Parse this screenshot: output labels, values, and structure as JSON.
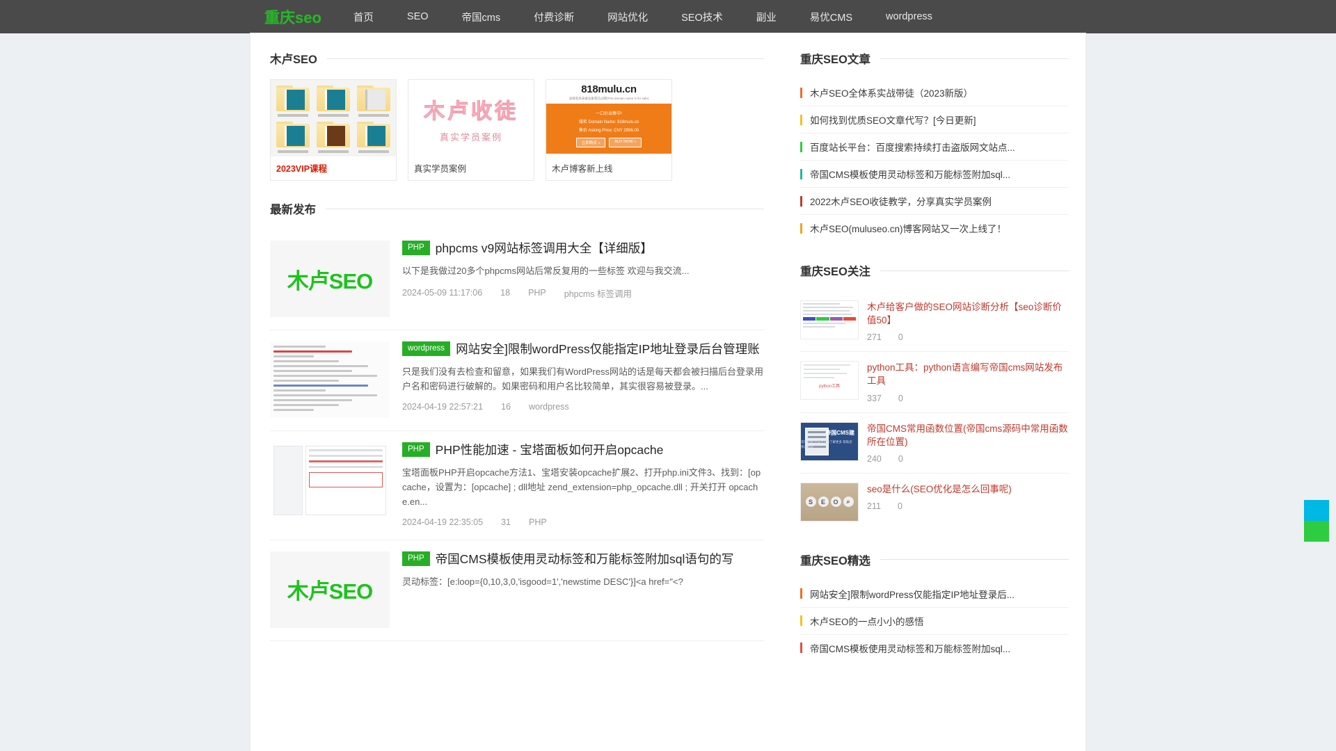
{
  "nav": {
    "logo": "重庆seo",
    "links": [
      {
        "label": "首页"
      },
      {
        "label": "SEO"
      },
      {
        "label": "帝国cms"
      },
      {
        "label": "付费诊断"
      },
      {
        "label": "网站优化"
      },
      {
        "label": "SEO技术"
      },
      {
        "label": "副业"
      },
      {
        "label": "易优CMS"
      },
      {
        "label": "wordpress"
      }
    ]
  },
  "main": {
    "featured_heading": "木卢SEO",
    "featured": [
      {
        "caption": "2023VIP课程",
        "kind": "folders",
        "highlight": true
      },
      {
        "caption": "真实学员案例",
        "kind": "mulu",
        "big": "木卢收徒",
        "sub": "真实学员案例",
        "highlight": false
      },
      {
        "caption": "木卢博客新上线",
        "kind": "mulu818",
        "domain": "818mulu.cn",
        "note": "该域名尚未被注册或已过期(This domain name is for sale)",
        "line1": "一口价出售中!",
        "line2": "域名 Domain Name: 818mulu.cn",
        "line3": "售价 Asking Price: CNY 2996.00",
        "btn1": "立即购买 »",
        "btn2": "BUY NOW »",
        "highlight": false
      }
    ],
    "latest_heading": "最新发布",
    "articles": [
      {
        "badge": "PHP",
        "title": "phpcms v9网站标签调用大全【详细版】",
        "desc": "以下是我做过20多个phpcms网站后常反复用的一些标签 欢迎与我交流...",
        "date": "2024-05-09 11:17:06",
        "views": "18",
        "category": "PHP",
        "tags": "phpcms 标签调用",
        "thumb": "muluseo"
      },
      {
        "badge": "wordpress",
        "title": "网站安全]限制wordPress仅能指定IP地址登录后台管理账",
        "desc": "只是我们没有去检查和留意，如果我们有WordPress网站的话是每天都会被扫描后台登录用户名和密码进行破解的。如果密码和用户名比较简单，其实很容易被登录。...",
        "date": "2024-04-19 22:57:21",
        "views": "16",
        "category": "wordpress",
        "tags": "",
        "thumb": "code"
      },
      {
        "badge": "PHP",
        "title": "PHP性能加速 - 宝塔面板如何开启opcache",
        "desc": "宝塔面板PHP开启opcache方法1、宝塔安装opcache扩展2、打开php.ini文件3、找到：[opcache，设置为：[opcache]\n; dll地址\nzend_extension=php_opcache.dll\n; 开关打开\nopcache.en...",
        "date": "2024-04-19 22:35:05",
        "views": "31",
        "category": "PHP",
        "tags": "",
        "thumb": "panel"
      },
      {
        "badge": "PHP",
        "title": "帝国CMS模板使用灵动标签和万能标签附加sql语句的写",
        "desc": "灵动标签：[e:loop={0,10,3,0,'isgood=1','newstime DESC'}]<a href=\"<?",
        "date": "",
        "views": "",
        "category": "",
        "tags": "",
        "thumb": "muluseo"
      }
    ]
  },
  "sidebar": {
    "articles_heading": "重庆SEO文章",
    "articles": [
      {
        "text": "木卢SEO全体系实战带徒（2023新版）",
        "color": "#f26c21"
      },
      {
        "text": "如何找到优质SEO文章代写？[今日更新]",
        "color": "#f2c21a"
      },
      {
        "text": "百度站长平台：百度搜索持续打击盗版网文站点...",
        "color": "#2ecc40"
      },
      {
        "text": "帝国CMS模板使用灵动标签和万能标签附加sql...",
        "color": "#1abc9c"
      },
      {
        "text": "2022木卢SEO收徒教学，分享真实学员案例",
        "color": "#c0392b"
      },
      {
        "text": "木卢SEO(muluseo.cn)博客网站又一次上线了！",
        "color": "#f1a417"
      }
    ],
    "follow_heading": "重庆SEO关注",
    "follow": [
      {
        "title": "木卢给客户做的SEO网站诊断分析【seo诊断价值50】",
        "views": "271",
        "comments": "0",
        "thumb": "sheet"
      },
      {
        "title": "python工具：python语言编写帝国cms网站发布工具",
        "views": "337",
        "comments": "0",
        "thumb": "py"
      },
      {
        "title": "帝国CMS常用函数位置(帝国cms源码中常用函数所在位置)",
        "views": "240",
        "comments": "0",
        "thumb": "blue"
      },
      {
        "title": "seo是什么(SEO优化是怎么回事呢)",
        "views": "211",
        "comments": "0",
        "thumb": "seo"
      }
    ],
    "picks_heading": "重庆SEO精选",
    "picks": [
      {
        "text": "网站安全]限制wordPress仅能指定IP地址登录后...",
        "color": "#f26c21"
      },
      {
        "text": "木卢SEO的一点小小的感悟",
        "color": "#f2c21a"
      },
      {
        "text": "帝国CMS模板使用灵动标签和万能标签附加sql...",
        "color": "#e74c3c"
      }
    ]
  },
  "floater": {
    "cells": [
      {
        "name": "qq-widget",
        "color": "#00b8e6"
      },
      {
        "name": "wechat-widget",
        "color": "#2ecc40"
      }
    ]
  },
  "blue_thumb": {
    "title": "帝国CMS建",
    "sub": "常用函数 位置大全\\n了解更多 帮助您快速建站"
  },
  "py_thumb": {
    "label": "python工具"
  }
}
